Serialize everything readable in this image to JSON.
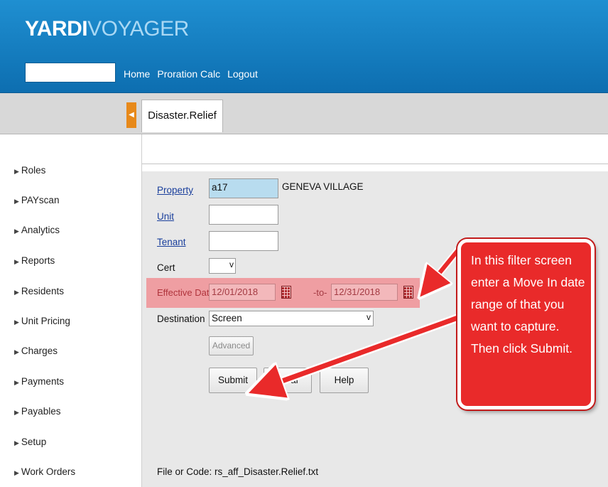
{
  "header": {
    "brand_bold": "YARDI",
    "brand_light": "VOYAGER",
    "nav": [
      "Home",
      "Proration Calc",
      "Logout"
    ]
  },
  "tab": {
    "label": "Disaster.Relief"
  },
  "sidebar": {
    "items": [
      "Roles",
      "PAYscan",
      "Analytics",
      "Reports",
      "Residents",
      "Unit Pricing",
      "Charges",
      "Payments",
      "Payables",
      "Setup",
      "Work Orders"
    ]
  },
  "form": {
    "property_label": "Property",
    "property_value": "a17",
    "property_name": "GENEVA VILLAGE",
    "unit_label": "Unit",
    "unit_value": "",
    "tenant_label": "Tenant",
    "tenant_value": "",
    "cert_label": "Cert",
    "cert_value": "",
    "effective_date_label": "Effective Date",
    "date_from": "12/01/2018",
    "date_to_label": "-to-",
    "date_to": "12/31/2018",
    "destination_label": "Destination",
    "destination_value": "Screen",
    "advanced_button": "Advanced",
    "submit_button": "Submit",
    "clear_button": "Clear",
    "help_button": "Help",
    "file_code_text": "File or Code: rs_aff_Disaster.Relief.txt"
  },
  "callout": {
    "text": "In this filter screen enter a Move In date range of that you want to capture.  Then click Submit."
  },
  "colors": {
    "header_blue": "#1580c4",
    "highlight_red": "#ef9a9e",
    "callout_red": "#e92a2a",
    "link_blue": "#1a3f9c"
  }
}
